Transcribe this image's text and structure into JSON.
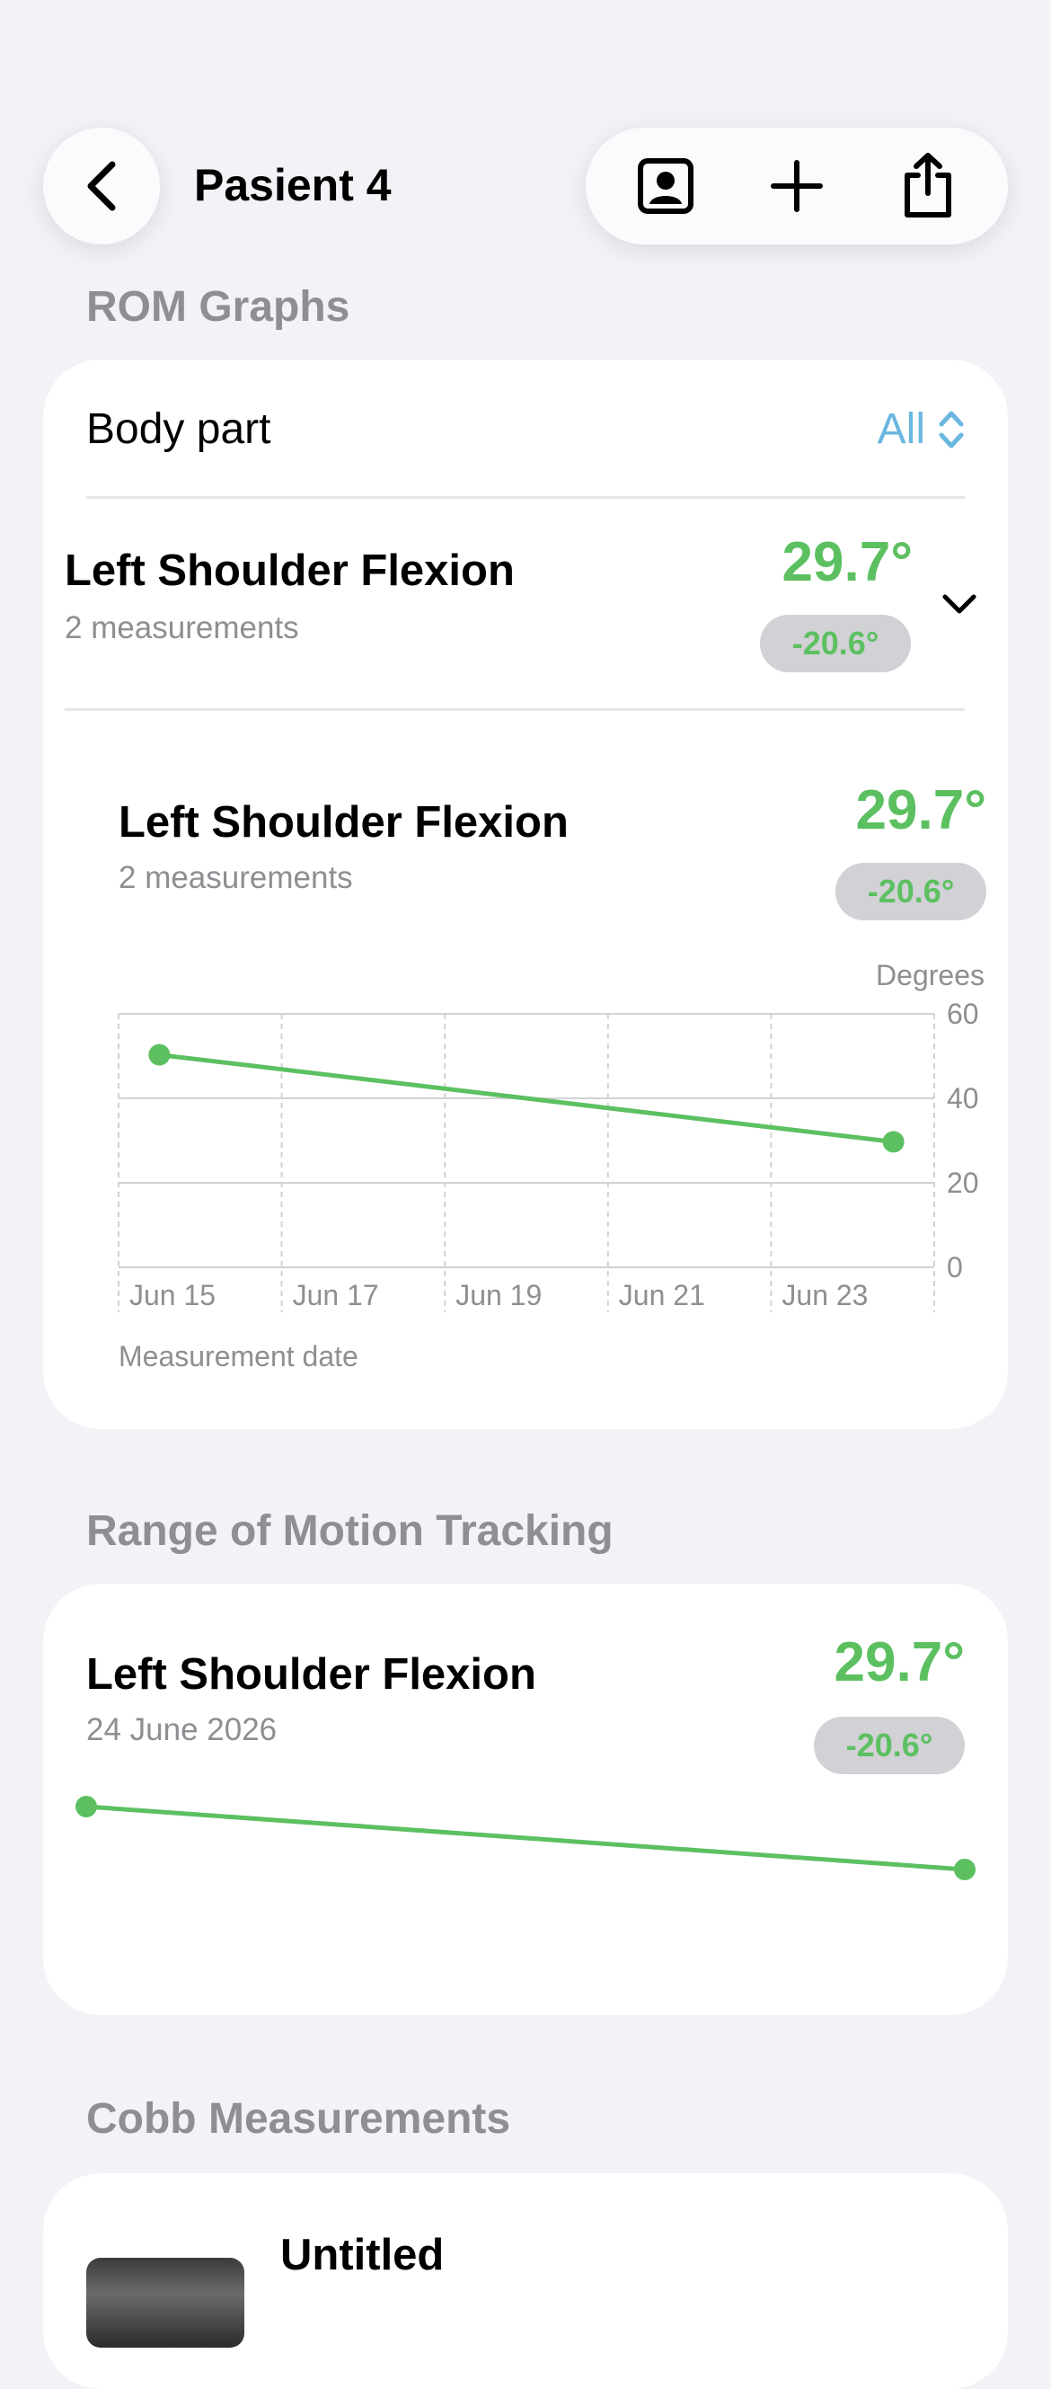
{
  "nav": {
    "title": "Pasient 4",
    "icons": [
      "chevron-left-icon",
      "contact-card-icon",
      "plus-icon",
      "share-icon"
    ]
  },
  "rom_graphs": {
    "section_title": "ROM Graphs",
    "body_part_label": "Body part",
    "body_part_value": "All",
    "summary_row": {
      "name": "Left Shoulder Flexion",
      "count": "2 measurements",
      "value": "29.7°",
      "delta": "-20.6°"
    },
    "chart_header": {
      "name": "Left Shoulder Flexion",
      "count": "2 measurements",
      "value": "29.7°",
      "delta": "-20.6°"
    }
  },
  "rom_tracking": {
    "section_title": "Range of Motion Tracking",
    "name": "Left Shoulder Flexion",
    "date": "24 June 2026",
    "value": "29.7°",
    "delta": "-20.6°"
  },
  "cobb": {
    "section_title": "Cobb Measurements",
    "first_item_title": "Untitled"
  },
  "colors": {
    "accent_green": "#5cc061",
    "link_blue": "#6ab7e0",
    "delta_pill_bg": "#d1d1d6"
  },
  "chart_data": {
    "type": "line",
    "ylabel": "Degrees",
    "xlabel": "Measurement date",
    "x_tick_labels": [
      "Jun 15",
      "Jun 17",
      "Jun 19",
      "Jun 21",
      "Jun 23"
    ],
    "x_ticks_day": [
      15,
      17,
      19,
      21,
      23
    ],
    "xlim_day": [
      15,
      25
    ],
    "ylim": [
      0,
      60
    ],
    "y_ticks": [
      0,
      20,
      40,
      60
    ],
    "series": [
      {
        "points": [
          {
            "x": "Jun 15",
            "day": 15.5,
            "y": 50.3
          },
          {
            "x": "Jun 24",
            "day": 24.5,
            "y": 29.7
          }
        ]
      }
    ],
    "grid": true
  },
  "sparkline_data": {
    "type": "line",
    "points": [
      {
        "y": 50.3
      },
      {
        "y": 29.7
      }
    ]
  }
}
